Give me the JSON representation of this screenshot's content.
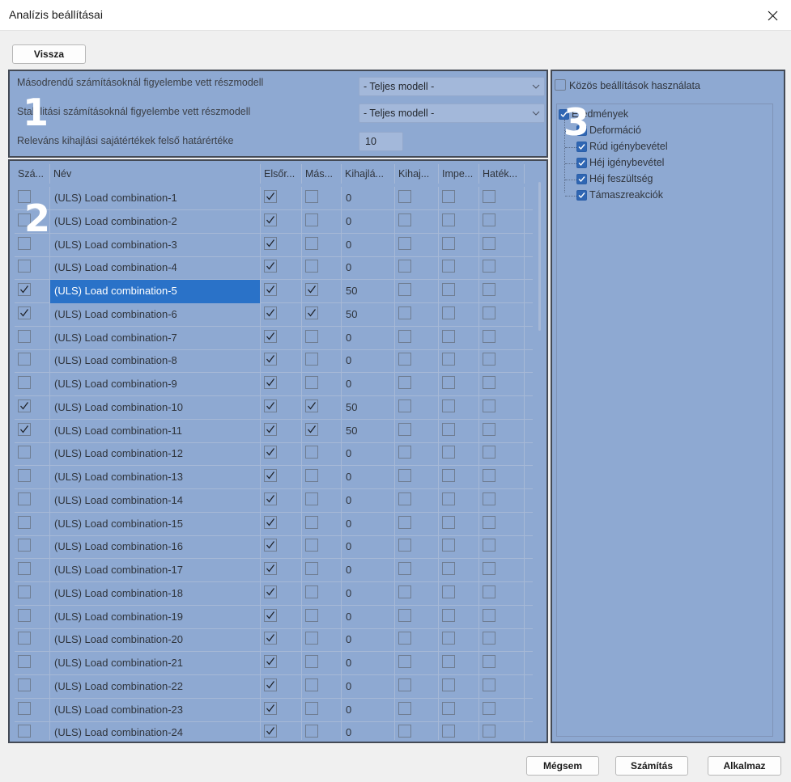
{
  "window": {
    "title": "Analízis beállításai"
  },
  "buttons": {
    "back": "Vissza",
    "cancel": "Mégsem",
    "calculate": "Számítás",
    "apply": "Alkalmaz"
  },
  "markers": {
    "one": "1",
    "two": "2",
    "three": "3"
  },
  "settings": {
    "second_order_label": "Másodrendű számításoknál figyelembe vett részmodell",
    "second_order_value": "- Teljes modell -",
    "stability_label": "Stabilitási számításoknál figyelembe vett részmodell",
    "stability_value": "- Teljes modell -",
    "eigen_label": "Releváns kihajlási sajátértékek felső határértéke",
    "eigen_value": "10"
  },
  "grid": {
    "columns": [
      "Szá...",
      "Név",
      "Elsőr...",
      "Más...",
      "Kihajlá...",
      "Kihaj...",
      "Impe...",
      "Haték..."
    ],
    "selected_row": 4,
    "rows": [
      {
        "calc": false,
        "name": "(ULS) Load combination-1",
        "first": true,
        "second": false,
        "buckling": "0",
        "c5": false,
        "c6": false,
        "c7": false
      },
      {
        "calc": false,
        "name": "(ULS) Load combination-2",
        "first": true,
        "second": false,
        "buckling": "0",
        "c5": false,
        "c6": false,
        "c7": false
      },
      {
        "calc": false,
        "name": "(ULS) Load combination-3",
        "first": true,
        "second": false,
        "buckling": "0",
        "c5": false,
        "c6": false,
        "c7": false
      },
      {
        "calc": false,
        "name": "(ULS) Load combination-4",
        "first": true,
        "second": false,
        "buckling": "0",
        "c5": false,
        "c6": false,
        "c7": false
      },
      {
        "calc": true,
        "name": "(ULS) Load combination-5",
        "first": true,
        "second": true,
        "buckling": "50",
        "c5": false,
        "c6": false,
        "c7": false
      },
      {
        "calc": true,
        "name": "(ULS) Load combination-6",
        "first": true,
        "second": true,
        "buckling": "50",
        "c5": false,
        "c6": false,
        "c7": false
      },
      {
        "calc": false,
        "name": "(ULS) Load combination-7",
        "first": true,
        "second": false,
        "buckling": "0",
        "c5": false,
        "c6": false,
        "c7": false
      },
      {
        "calc": false,
        "name": "(ULS) Load combination-8",
        "first": true,
        "second": false,
        "buckling": "0",
        "c5": false,
        "c6": false,
        "c7": false
      },
      {
        "calc": false,
        "name": "(ULS) Load combination-9",
        "first": true,
        "second": false,
        "buckling": "0",
        "c5": false,
        "c6": false,
        "c7": false
      },
      {
        "calc": true,
        "name": "(ULS) Load combination-10",
        "first": true,
        "second": true,
        "buckling": "50",
        "c5": false,
        "c6": false,
        "c7": false
      },
      {
        "calc": true,
        "name": "(ULS) Load combination-11",
        "first": true,
        "second": true,
        "buckling": "50",
        "c5": false,
        "c6": false,
        "c7": false
      },
      {
        "calc": false,
        "name": "(ULS) Load combination-12",
        "first": true,
        "second": false,
        "buckling": "0",
        "c5": false,
        "c6": false,
        "c7": false
      },
      {
        "calc": false,
        "name": "(ULS) Load combination-13",
        "first": true,
        "second": false,
        "buckling": "0",
        "c5": false,
        "c6": false,
        "c7": false
      },
      {
        "calc": false,
        "name": "(ULS) Load combination-14",
        "first": true,
        "second": false,
        "buckling": "0",
        "c5": false,
        "c6": false,
        "c7": false
      },
      {
        "calc": false,
        "name": "(ULS) Load combination-15",
        "first": true,
        "second": false,
        "buckling": "0",
        "c5": false,
        "c6": false,
        "c7": false
      },
      {
        "calc": false,
        "name": "(ULS) Load combination-16",
        "first": true,
        "second": false,
        "buckling": "0",
        "c5": false,
        "c6": false,
        "c7": false
      },
      {
        "calc": false,
        "name": "(ULS) Load combination-17",
        "first": true,
        "second": false,
        "buckling": "0",
        "c5": false,
        "c6": false,
        "c7": false
      },
      {
        "calc": false,
        "name": "(ULS) Load combination-18",
        "first": true,
        "second": false,
        "buckling": "0",
        "c5": false,
        "c6": false,
        "c7": false
      },
      {
        "calc": false,
        "name": "(ULS) Load combination-19",
        "first": true,
        "second": false,
        "buckling": "0",
        "c5": false,
        "c6": false,
        "c7": false
      },
      {
        "calc": false,
        "name": "(ULS) Load combination-20",
        "first": true,
        "second": false,
        "buckling": "0",
        "c5": false,
        "c6": false,
        "c7": false
      },
      {
        "calc": false,
        "name": "(ULS) Load combination-21",
        "first": true,
        "second": false,
        "buckling": "0",
        "c5": false,
        "c6": false,
        "c7": false
      },
      {
        "calc": false,
        "name": "(ULS) Load combination-22",
        "first": true,
        "second": false,
        "buckling": "0",
        "c5": false,
        "c6": false,
        "c7": false
      },
      {
        "calc": false,
        "name": "(ULS) Load combination-23",
        "first": true,
        "second": false,
        "buckling": "0",
        "c5": false,
        "c6": false,
        "c7": false
      },
      {
        "calc": false,
        "name": "(ULS) Load combination-24",
        "first": true,
        "second": false,
        "buckling": "0",
        "c5": false,
        "c6": false,
        "c7": false
      }
    ]
  },
  "results": {
    "shared_settings_label": "Közös beállítások használata",
    "shared_settings_checked": false,
    "root": "Eredmények",
    "items": [
      "Deformáció",
      "Rúd igénybevétel",
      "Héj igénybevétel",
      "Héj feszültség",
      "Támaszreakciók"
    ]
  },
  "colors": {
    "panel": "#8ea9d2",
    "selection": "#2a72c8",
    "checkbox_fill": "#2f66b3"
  }
}
